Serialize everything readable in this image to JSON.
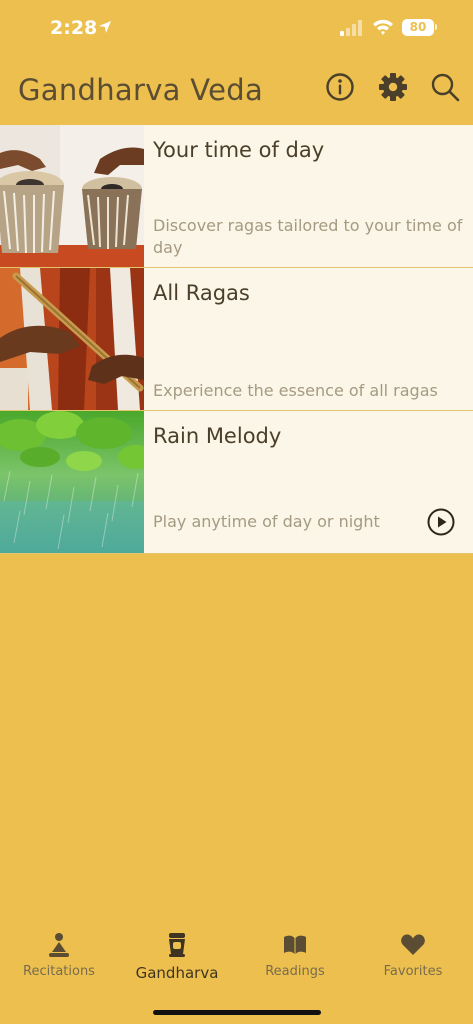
{
  "status_bar": {
    "time": "2:28",
    "battery": "80"
  },
  "header": {
    "title": "Gandharva Veda"
  },
  "list": [
    {
      "title": "Your time of day",
      "description": "Discover ragas tailored to your time of day"
    },
    {
      "title": "All Ragas",
      "description": "Experience the essence of all ragas"
    },
    {
      "title": "Rain Melody",
      "description": "Play anytime of day or night"
    }
  ],
  "tabs": [
    {
      "label": "Recitations",
      "icon": "meditation-icon"
    },
    {
      "label": "Gandharva",
      "icon": "drum-icon",
      "active": true
    },
    {
      "label": "Readings",
      "icon": "book-icon"
    },
    {
      "label": "Favorites",
      "icon": "heart-icon"
    }
  ],
  "colors": {
    "background": "#ecbf4e",
    "card": "#fcf6e8",
    "text": "#4a3f2a"
  }
}
